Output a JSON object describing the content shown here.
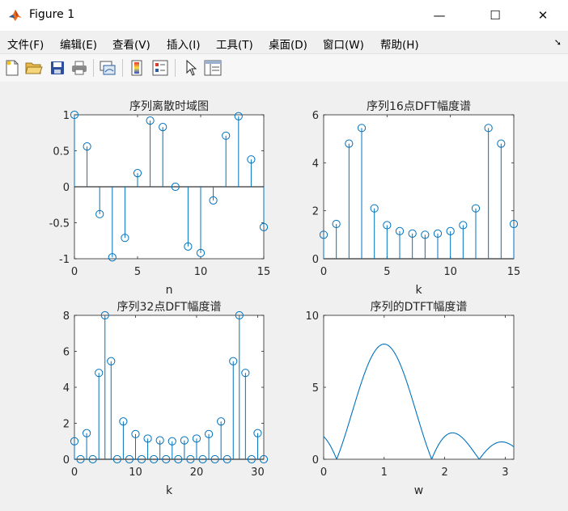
{
  "window": {
    "title": "Figure 1",
    "minimize": "—",
    "maximize": "☐",
    "close": "✕"
  },
  "menu": [
    "文件(F)",
    "编辑(E)",
    "查看(V)",
    "插入(I)",
    "工具(T)",
    "桌面(D)",
    "窗口(W)",
    "帮助(H)"
  ],
  "toolbar": [
    "new-figure-icon",
    "open-file-icon",
    "save-icon",
    "print-icon",
    "link-plot-icon",
    "insert-colorbar-icon",
    "insert-legend-icon",
    "edit-plot-icon",
    "property-inspector-icon"
  ],
  "colors": {
    "stem": "#0072bd"
  },
  "chart_data": [
    {
      "type": "stem",
      "title": "序列离散时域图",
      "xlabel": "n",
      "x": [
        0,
        1,
        2,
        3,
        4,
        5,
        6,
        7,
        8,
        9,
        10,
        11,
        12,
        13,
        14,
        15
      ],
      "values": [
        1.0,
        0.56,
        -0.38,
        -0.98,
        -0.71,
        0.19,
        0.92,
        0.83,
        0.0,
        -0.83,
        -0.92,
        -0.19,
        0.71,
        0.98,
        0.38,
        -0.56
      ],
      "xlim": [
        0,
        15
      ],
      "ylim": [
        -1,
        1
      ],
      "xticks": [
        0,
        5,
        10,
        15
      ],
      "yticks": [
        -1,
        -0.5,
        0,
        0.5,
        1
      ],
      "xticklabels": [
        "0",
        "5",
        "10",
        "15"
      ],
      "yticklabels": [
        "-1",
        "-0.5",
        "0",
        "0.5",
        "1"
      ]
    },
    {
      "type": "stem",
      "title": "序列16点DFT幅度谱",
      "xlabel": "k",
      "x": [
        0,
        1,
        2,
        3,
        4,
        5,
        6,
        7,
        8,
        9,
        10,
        11,
        12,
        13,
        14,
        15
      ],
      "values": [
        1.0,
        1.45,
        4.8,
        5.45,
        2.1,
        1.4,
        1.15,
        1.05,
        1.0,
        1.05,
        1.15,
        1.4,
        2.1,
        5.45,
        4.8,
        1.45
      ],
      "xlim": [
        0,
        15
      ],
      "ylim": [
        0,
        6
      ],
      "xticks": [
        0,
        5,
        10,
        15
      ],
      "yticks": [
        0,
        2,
        4,
        6
      ],
      "xticklabels": [
        "0",
        "5",
        "10",
        "15"
      ],
      "yticklabels": [
        "0",
        "2",
        "4",
        "6"
      ]
    },
    {
      "type": "stem",
      "title": "序列32点DFT幅度谱",
      "xlabel": "k",
      "x": [
        0,
        1,
        2,
        3,
        4,
        5,
        6,
        7,
        8,
        9,
        10,
        11,
        12,
        13,
        14,
        15,
        16,
        17,
        18,
        19,
        20,
        21,
        22,
        23,
        24,
        25,
        26,
        27,
        28,
        29,
        30,
        31
      ],
      "values": [
        1.0,
        0.0,
        1.45,
        0.0,
        4.8,
        8.0,
        5.45,
        0.0,
        2.1,
        0.0,
        1.4,
        0.0,
        1.15,
        0.0,
        1.05,
        0.0,
        1.0,
        0.0,
        1.05,
        0.0,
        1.15,
        0.0,
        1.4,
        0.0,
        2.1,
        0.0,
        5.45,
        8.0,
        4.8,
        0.0,
        1.45,
        0.0
      ],
      "xlim": [
        0,
        31
      ],
      "ylim": [
        0,
        8
      ],
      "xticks": [
        0,
        10,
        20,
        30
      ],
      "yticks": [
        0,
        2,
        4,
        6,
        8
      ],
      "xticklabels": [
        "0",
        "10",
        "20",
        "30"
      ],
      "yticklabels": [
        "0",
        "2",
        "4",
        "6",
        "8"
      ]
    },
    {
      "type": "line",
      "title": "序列的DTFT幅度谱",
      "xlabel": "w",
      "xlim": [
        0,
        3.1416
      ],
      "ylim": [
        0,
        10
      ],
      "xticks": [
        0,
        1,
        2,
        3
      ],
      "yticks": [
        0,
        5,
        10
      ],
      "xticklabels": [
        "0",
        "1",
        "2",
        "3"
      ],
      "yticklabels": [
        "0",
        "5",
        "10"
      ],
      "formula": "|sin(4(w-w0))/sin((w-w0)/2)| with w0=1",
      "w0": 1.0
    }
  ]
}
